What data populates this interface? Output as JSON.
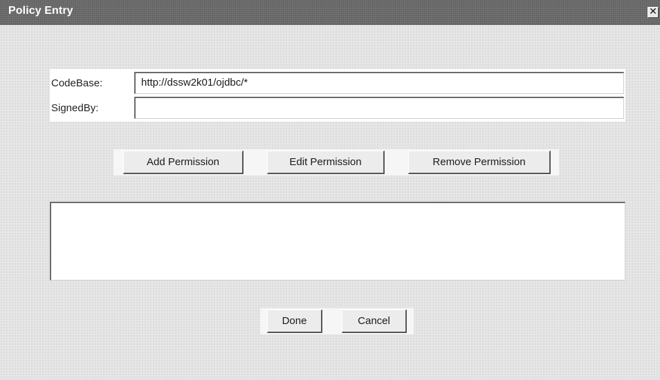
{
  "window": {
    "title": "Policy Entry",
    "close_glyph": "✕",
    "close_icon": "close-icon"
  },
  "fields": {
    "codebase": {
      "label": "CodeBase:",
      "value": "http://dssw2k01/ojdbc/*"
    },
    "signedby": {
      "label": "SignedBy:",
      "value": ""
    }
  },
  "permission_buttons": {
    "add": "Add Permission",
    "edit": "Edit Permission",
    "remove": "Remove Permission"
  },
  "permissions_list": {
    "items": []
  },
  "footer_buttons": {
    "done": "Done",
    "cancel": "Cancel"
  }
}
